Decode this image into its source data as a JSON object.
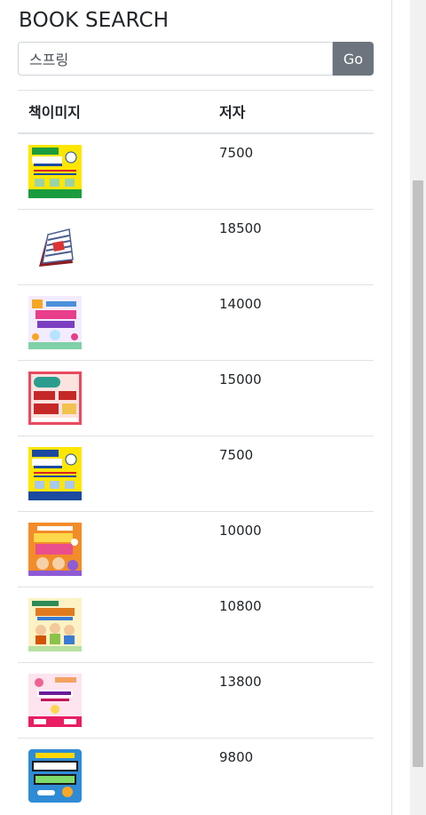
{
  "page": {
    "title": "BOOK SEARCH"
  },
  "search": {
    "value": "스프링",
    "button_label": "Go"
  },
  "table": {
    "columns": [
      "책이미지",
      "저자"
    ],
    "rows": [
      {
        "cover": "sudoku-yellow-book-cover",
        "price": "7500"
      },
      {
        "cover": "desk-calendar-book-cover",
        "price": "18500"
      },
      {
        "cover": "phonics-sound-book-cover",
        "price": "14000"
      },
      {
        "cover": "daily-365-book-cover",
        "price": "15000"
      },
      {
        "cover": "sudoku-blue-book-cover",
        "price": "7500"
      },
      {
        "cover": "orange-comic-book-cover",
        "price": "10000"
      },
      {
        "cover": "kids-cartoon-book-cover",
        "price": "10800"
      },
      {
        "cover": "phonics-pink-book-cover",
        "price": "13800"
      },
      {
        "cover": "crossword-blue-book-cover",
        "price": "9800"
      }
    ]
  },
  "colors": {
    "button": "#6c757d",
    "border": "#dee2e6",
    "scroll_thumb": "#c1c1c1"
  }
}
